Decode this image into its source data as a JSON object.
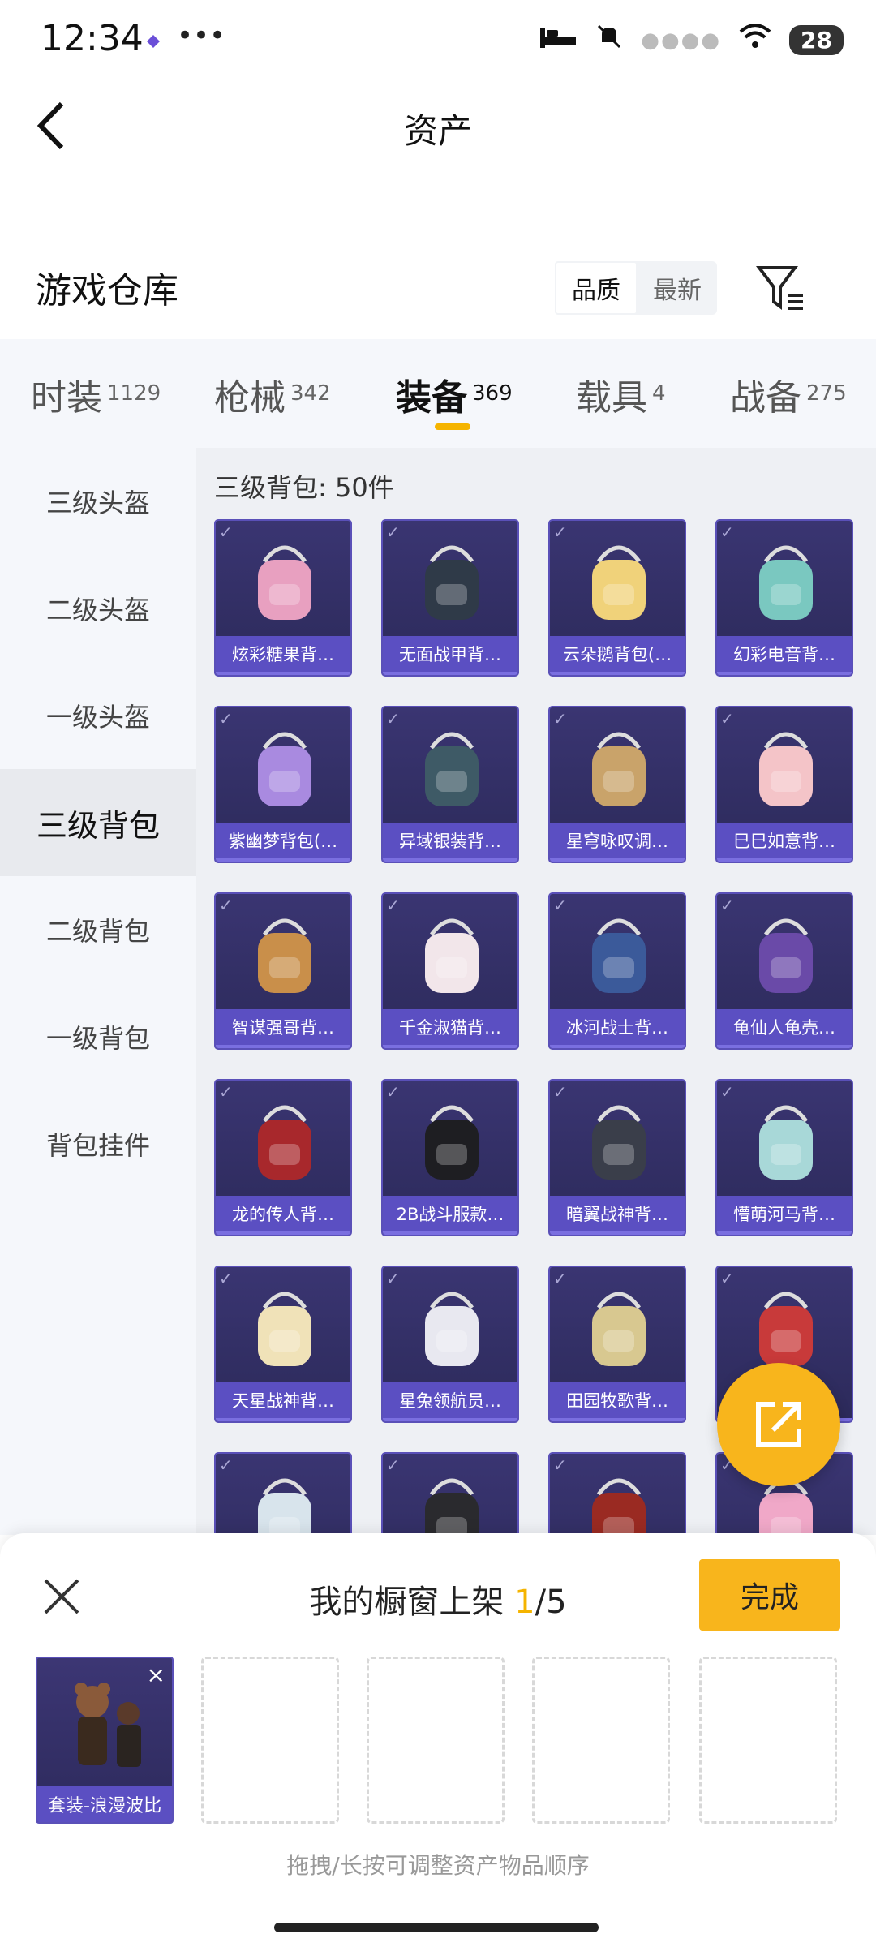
{
  "status_bar": {
    "time": "12:34",
    "dots": "•••",
    "battery": "28"
  },
  "header": {
    "title": "资产"
  },
  "section": {
    "title": "游戏仓库",
    "sort_quality": "品质",
    "sort_newest": "最新"
  },
  "tabs": [
    {
      "label": "时装",
      "count": "1129"
    },
    {
      "label": "枪械",
      "count": "342"
    },
    {
      "label": "装备",
      "count": "369"
    },
    {
      "label": "载具",
      "count": "4"
    },
    {
      "label": "战备",
      "count": "275"
    }
  ],
  "sidebar": [
    {
      "label": "三级头盔"
    },
    {
      "label": "二级头盔"
    },
    {
      "label": "一级头盔"
    },
    {
      "label": "三级背包"
    },
    {
      "label": "二级背包"
    },
    {
      "label": "一级背包"
    },
    {
      "label": "背包挂件"
    }
  ],
  "grid": {
    "heading": "三级背包: 50件",
    "items": [
      {
        "name": "炫彩糖果背…",
        "color": "#e8a0c0"
      },
      {
        "name": "无面战甲背…",
        "color": "#2f3a48"
      },
      {
        "name": "云朵鹅背包(…",
        "color": "#f0d27a"
      },
      {
        "name": "幻彩电音背…",
        "color": "#7ac8c0"
      },
      {
        "name": "紫幽梦背包(…",
        "color": "#a98ae0"
      },
      {
        "name": "异域银装背…",
        "color": "#3e5a66"
      },
      {
        "name": "星穹咏叹调…",
        "color": "#c9a36a"
      },
      {
        "name": "巳巳如意背…",
        "color": "#f4c4c8"
      },
      {
        "name": "智谋强哥背…",
        "color": "#c98f4a"
      },
      {
        "name": "千金淑猫背…",
        "color": "#f2e6ea"
      },
      {
        "name": "冰河战士背…",
        "color": "#3b5a9a"
      },
      {
        "name": "龟仙人龟壳…",
        "color": "#6a4aa8"
      },
      {
        "name": "龙的传人背…",
        "color": "#a8282c"
      },
      {
        "name": "2B战斗服款…",
        "color": "#1e1e22"
      },
      {
        "name": "暗翼战神背…",
        "color": "#3a3e4a"
      },
      {
        "name": "懵萌河马背…",
        "color": "#a8d8d8"
      },
      {
        "name": "天星战神背…",
        "color": "#f0e2b8"
      },
      {
        "name": "星兔领航员…",
        "color": "#e8e8f0"
      },
      {
        "name": "田园牧歌背…",
        "color": "#d8c890"
      },
      {
        "name": "",
        "color": "#c83a3a"
      },
      {
        "name": "",
        "color": "#d8e4ec"
      },
      {
        "name": "",
        "color": "#2a2a2e"
      },
      {
        "name": "",
        "color": "#9a2a22"
      },
      {
        "name": "",
        "color": "#f0a8c8"
      }
    ]
  },
  "showcase": {
    "title_prefix": "我的橱窗上架 ",
    "count": "1",
    "total": "/5",
    "done_label": "完成",
    "filled_item": "套装-浪漫波比",
    "hint": "拖拽/长按可调整资产物品顺序"
  }
}
